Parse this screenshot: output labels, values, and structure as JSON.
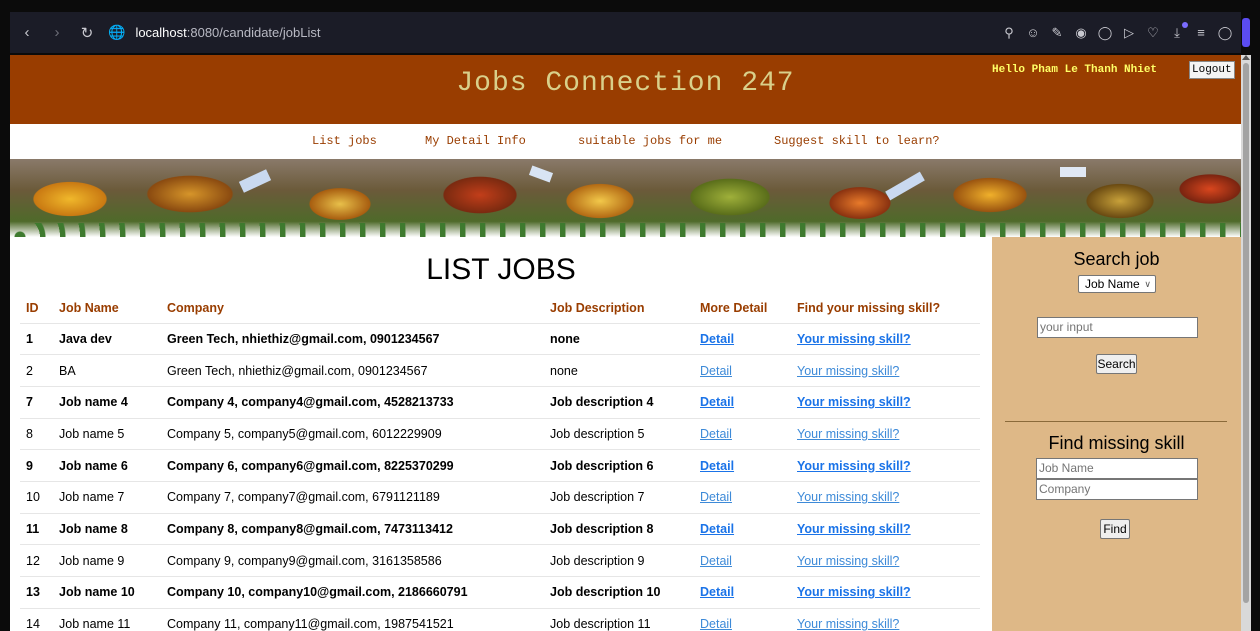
{
  "browser": {
    "url_host": "localhost",
    "url_rest": ":8080/candidate/jobList"
  },
  "header": {
    "site_title": "Jobs Connection 247",
    "greeting": "Hello Pham Le Thanh Nhiet",
    "logout_label": "Logout"
  },
  "menu": {
    "items": [
      "List jobs",
      "My Detail Info",
      "suitable jobs for me",
      "Suggest skill to learn?"
    ]
  },
  "main": {
    "heading": "LIST JOBS",
    "columns": [
      "ID",
      "Job Name",
      "Company",
      "Job Description",
      "More Detail",
      "Find your missing skill?"
    ],
    "rows": [
      {
        "id": "1",
        "name": "Java dev",
        "company": "Green Tech, nhiethiz@gmail.com, 0901234567",
        "description": "none",
        "detail": "Detail",
        "missing": "Your missing skill?"
      },
      {
        "id": "2",
        "name": "BA",
        "company": "Green Tech, nhiethiz@gmail.com, 0901234567",
        "description": "none",
        "detail": "Detail",
        "missing": "Your missing skill?"
      },
      {
        "id": "7",
        "name": "Job name 4",
        "company": "Company 4, company4@gmail.com, 4528213733",
        "description": "Job description 4",
        "detail": "Detail",
        "missing": "Your missing skill?"
      },
      {
        "id": "8",
        "name": "Job name 5",
        "company": "Company 5, company5@gmail.com, 6012229909",
        "description": "Job description 5",
        "detail": "Detail",
        "missing": "Your missing skill?"
      },
      {
        "id": "9",
        "name": "Job name 6",
        "company": "Company 6, company6@gmail.com, 8225370299",
        "description": "Job description 6",
        "detail": "Detail",
        "missing": "Your missing skill?"
      },
      {
        "id": "10",
        "name": "Job name 7",
        "company": "Company 7, company7@gmail.com, 6791121189",
        "description": "Job description 7",
        "detail": "Detail",
        "missing": "Your missing skill?"
      },
      {
        "id": "11",
        "name": "Job name 8",
        "company": "Company 8, company8@gmail.com, 7473113412",
        "description": "Job description 8",
        "detail": "Detail",
        "missing": "Your missing skill?"
      },
      {
        "id": "12",
        "name": "Job name 9",
        "company": "Company 9, company9@gmail.com, 3161358586",
        "description": "Job description 9",
        "detail": "Detail",
        "missing": "Your missing skill?"
      },
      {
        "id": "13",
        "name": "Job name 10",
        "company": "Company 10, company10@gmail.com, 2186660791",
        "description": "Job description 10",
        "detail": "Detail",
        "missing": "Your missing skill?"
      },
      {
        "id": "14",
        "name": "Job name 11",
        "company": "Company 11, company11@gmail.com, 1987541521",
        "description": "Job description 11",
        "detail": "Detail",
        "missing": "Your missing skill?"
      }
    ]
  },
  "sidebar": {
    "search_title": "Search job",
    "search_select_value": "Job Name",
    "search_input_placeholder": "your input",
    "search_button": "Search",
    "missing_title": "Find missing skill",
    "job_name_placeholder": "Job Name",
    "company_placeholder": "Company",
    "find_button": "Find"
  },
  "colors": {
    "header_bg": "#993d00",
    "title_color": "#d9d08a",
    "greeting_color": "#ffff66",
    "accent": "#993d00",
    "sidebar_bg": "#deb887",
    "link": "#1a73e8"
  }
}
